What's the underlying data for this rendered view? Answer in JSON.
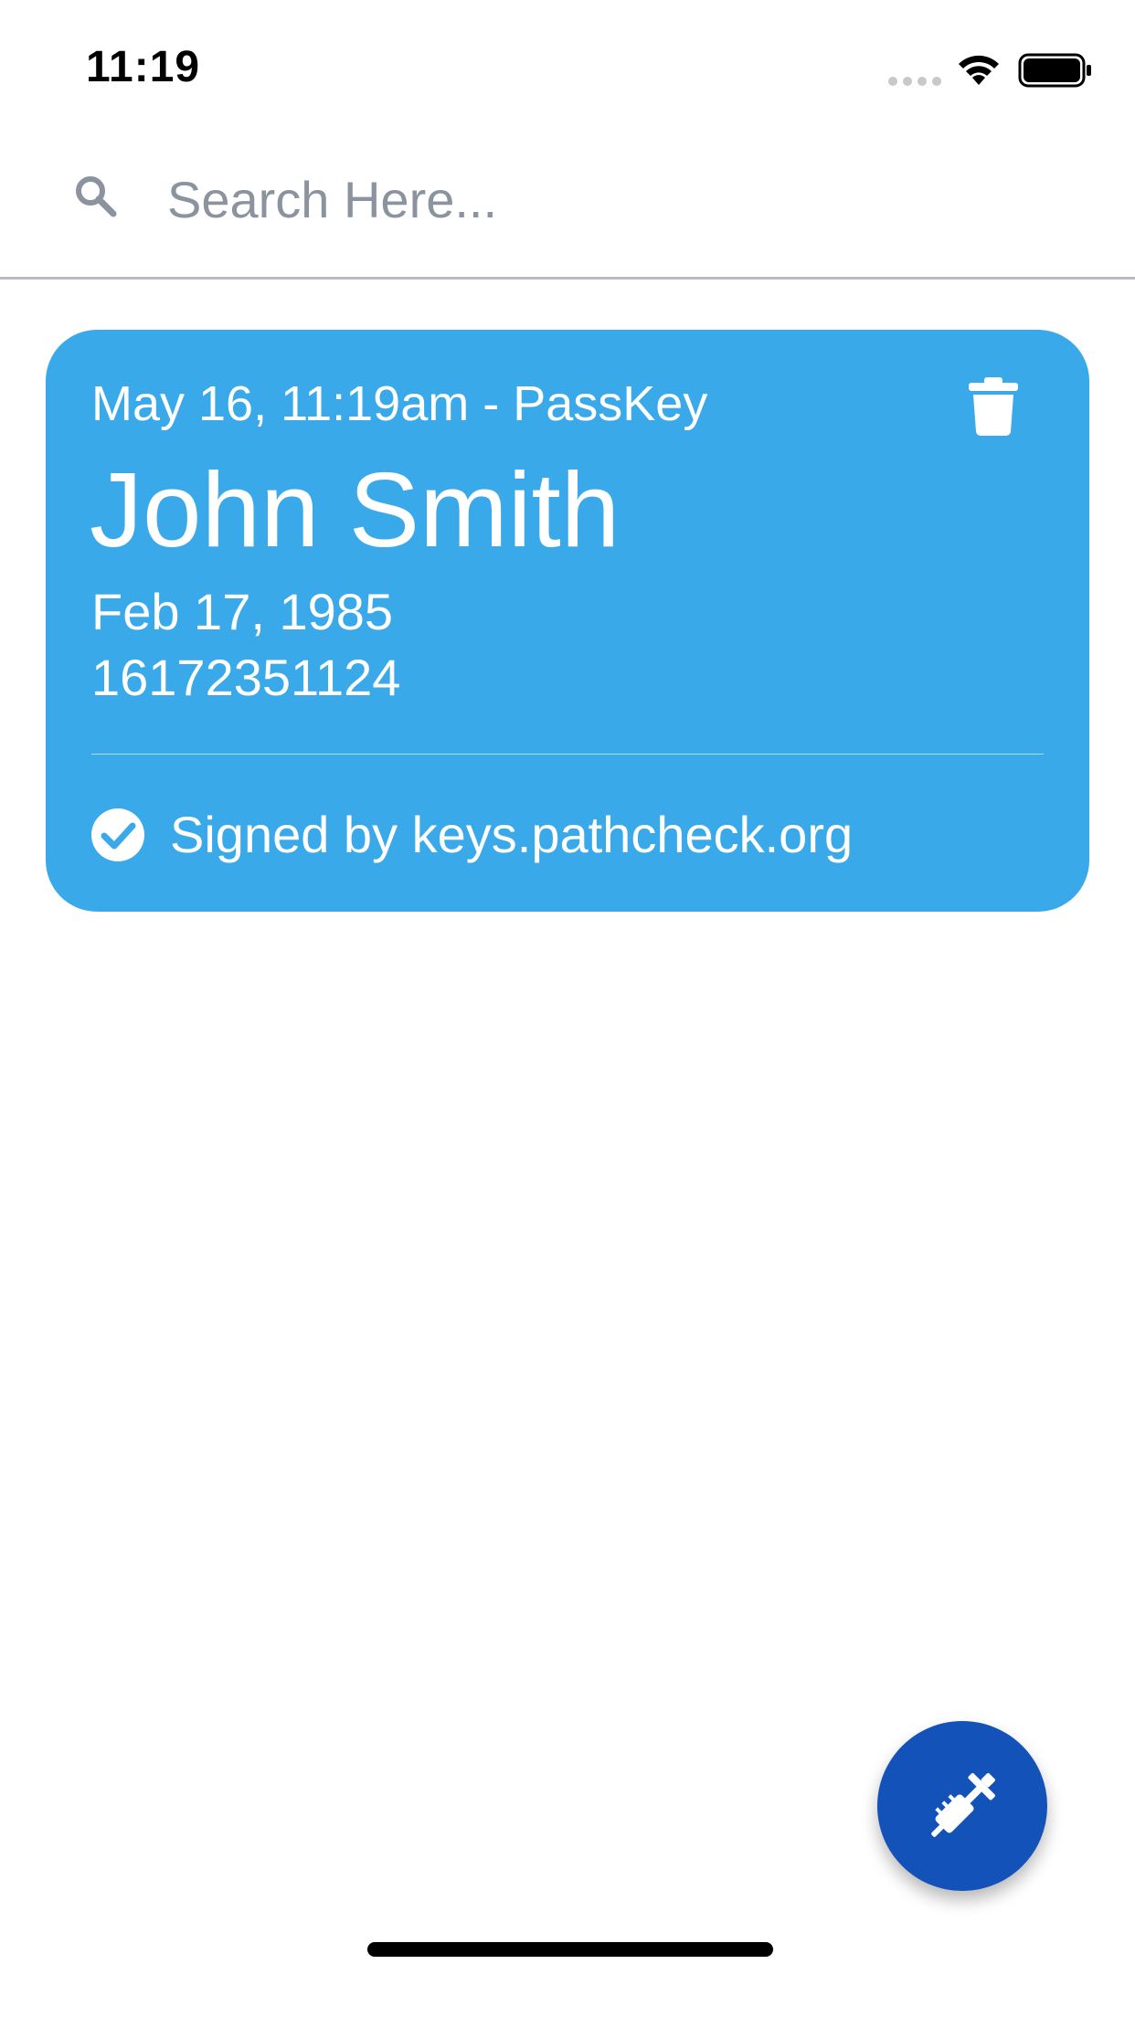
{
  "status_bar": {
    "time": "11:19"
  },
  "search": {
    "placeholder": "Search Here...",
    "value": ""
  },
  "cards": [
    {
      "meta": "May 16, 11:19am - PassKey",
      "name": "John Smith",
      "dob": "Feb 17, 1985",
      "phone": "16172351124",
      "signed_by": "Signed by keys.pathcheck.org",
      "delete_icon": "trash-icon",
      "verified_icon": "check-circle-icon"
    }
  ],
  "fab": {
    "icon": "syringe-icon"
  },
  "colors": {
    "card_background": "#3aa9ea",
    "fab_background": "#1352b8",
    "divider": "#b8bcc2",
    "placeholder": "#8a939e"
  }
}
